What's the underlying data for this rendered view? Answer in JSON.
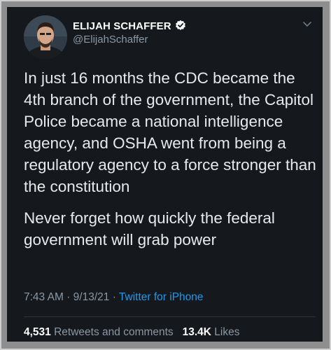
{
  "author": {
    "name": "ELIJAH SCHAFFER",
    "handle": "@ElijahSchaffer",
    "verified": true
  },
  "tweet": {
    "paragraphs": [
      "In just 16 months the CDC became the 4th branch of the government, the Capitol Police became a national intelligence agency, and OSHA went from being a regulatory agency to a force stronger than the constitution",
      "Never forget how quickly the federal government will grab power"
    ],
    "time": "7:43 AM",
    "date": "9/13/21",
    "separator": "·",
    "source": "Twitter for iPhone"
  },
  "stats": {
    "retweets_count": "4,531",
    "retweets_label": "Retweets and comments",
    "likes_count": "13.4K",
    "likes_label": "Likes"
  },
  "colors": {
    "background": "#15181c",
    "link": "#1d9bf0",
    "secondary_text": "#8b98a5",
    "verified_badge": "#ffffff"
  },
  "icons": {
    "verified": "verified-badge-icon",
    "menu": "chevron-down-icon"
  }
}
